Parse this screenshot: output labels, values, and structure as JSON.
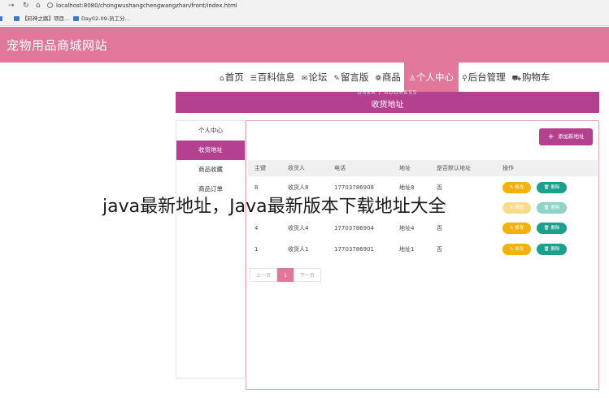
{
  "browser": {
    "url": "localhost:8080/chongwushangchengwangzhan/front/index.html",
    "bookmarks": [
      "【码神之路】项目...",
      "Day02-09-员工分..."
    ]
  },
  "site": {
    "title": "宠物用品商城网站"
  },
  "nav": {
    "items": [
      {
        "label": "首页",
        "icon": "⌂"
      },
      {
        "label": "百科信息",
        "icon": "☰"
      },
      {
        "label": "论坛",
        "icon": "✉"
      },
      {
        "label": "留言版",
        "icon": "✎"
      },
      {
        "label": "商品",
        "icon": "❁"
      },
      {
        "label": "个人中心",
        "icon": "♙",
        "active": true
      },
      {
        "label": "后台管理",
        "icon": "⚲"
      },
      {
        "label": "购物车",
        "icon": "⛟"
      }
    ]
  },
  "banner": {
    "subtitle": "USER / ADDRESS",
    "title": "收货地址"
  },
  "sidebar": {
    "items": [
      "个人中心",
      "收货地址",
      "商品收藏",
      "商品订单"
    ],
    "active_index": 1
  },
  "toolbar": {
    "add_label": "添加新地址"
  },
  "table": {
    "headers": [
      "主键",
      "收货人",
      "电话",
      "地址",
      "是否默认地址",
      "操作"
    ],
    "rows": [
      {
        "id": "8",
        "name": "收货人8",
        "phone": "17703786908",
        "address": "地址8",
        "default": "否"
      },
      {
        "id": "",
        "name": "",
        "phone": "",
        "address": "",
        "default": ""
      },
      {
        "id": "4",
        "name": "收货人4",
        "phone": "17703786904",
        "address": "地址4",
        "default": "否"
      },
      {
        "id": "1",
        "name": "收货人1",
        "phone": "17703786901",
        "address": "地址1",
        "default": "否"
      }
    ],
    "edit_label": "修改",
    "delete_label": "删除"
  },
  "pager": {
    "prev": "上一页",
    "current": "1",
    "next": "下一页"
  },
  "watermark": {
    "text": "java最新地址，Java最新版本下载地址大全"
  },
  "colors": {
    "header": "#e1779a",
    "accent": "#b3418f",
    "edit": "#f3b10d",
    "delete": "#1aa08c"
  }
}
